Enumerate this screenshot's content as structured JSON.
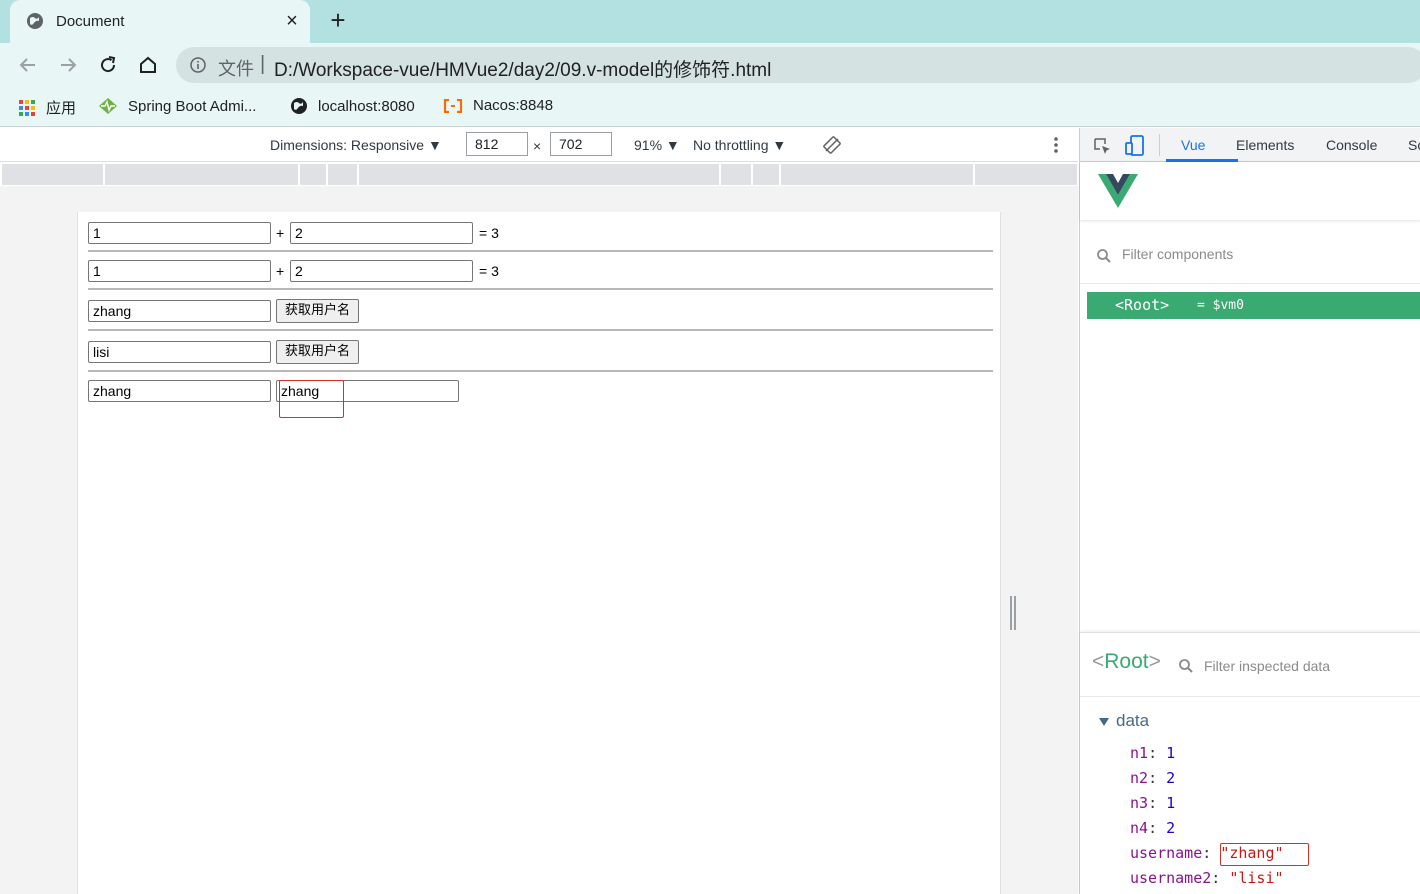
{
  "browser": {
    "tab_title": "Document",
    "tab_close": "×",
    "new_tab": "+",
    "omnibox_scheme": "文件",
    "omnibox_sep": "|",
    "url": "D:/Workspace-vue/HMVue2/day2/09.v-model的修饰符.html",
    "bookmarks": [
      {
        "label": "应用",
        "icon": "apps-grid-icon"
      },
      {
        "label": "Spring Boot Admi...",
        "icon": "spring-boot-admin-icon"
      },
      {
        "label": "localhost:8080",
        "icon": "globe-icon"
      },
      {
        "label": "Nacos:8848",
        "icon": "nacos-icon"
      }
    ]
  },
  "device_toolbar": {
    "dimensions": "Dimensions: Responsive ▼",
    "width": "812",
    "times": "×",
    "height": "702",
    "zoom": "91% ▼",
    "throttling": "No throttling ▼"
  },
  "page": {
    "row1": {
      "n1": "1",
      "plus": "+",
      "n2": "2",
      "result": "= 3"
    },
    "row2": {
      "n1": "1",
      "plus": "+",
      "n2": "2",
      "result": "= 3"
    },
    "row3": {
      "input": "zhang",
      "button": "获取用户名"
    },
    "row4": {
      "input": "lisi",
      "button": "获取用户名"
    },
    "row5": {
      "input1": "zhang",
      "input2": "zhang"
    }
  },
  "devtools": {
    "tabs": [
      "Vue",
      "Elements",
      "Console",
      "So"
    ],
    "filter_components_placeholder": "Filter components",
    "root_tag": "<Root>",
    "root_vm": "= $vm0",
    "inspector_root": "Root",
    "inspector_root_open": "<",
    "inspector_root_close": ">",
    "filter_data_placeholder": "Filter inspected data",
    "data_section": "data",
    "data": [
      {
        "key": "n1",
        "value": "1",
        "type": "num"
      },
      {
        "key": "n2",
        "value": "2",
        "type": "num"
      },
      {
        "key": "n3",
        "value": "1",
        "type": "num"
      },
      {
        "key": "n4",
        "value": "2",
        "type": "num"
      },
      {
        "key": "username",
        "value": "\"zhang\"",
        "type": "str"
      },
      {
        "key": "username2",
        "value": "\"lisi\"",
        "type": "str"
      }
    ],
    "colors": {
      "vue_green": "#3aaa72",
      "vue_dark": "#34495e",
      "active_tab": "#1a73e8"
    }
  }
}
